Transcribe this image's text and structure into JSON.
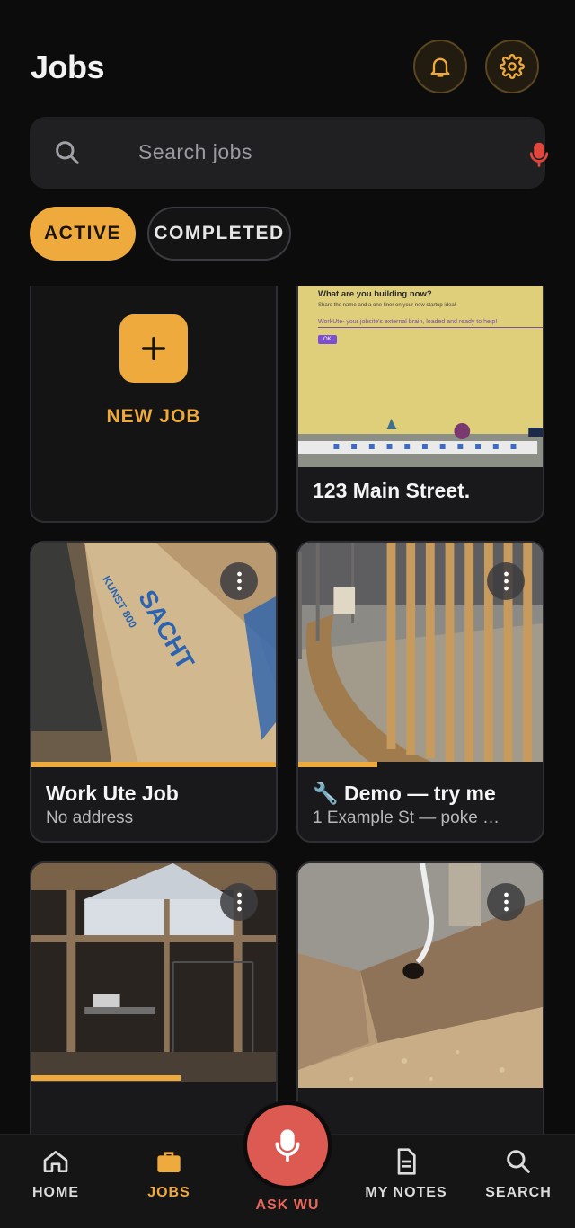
{
  "header": {
    "title": "Jobs",
    "notifications_icon": "bell-icon",
    "settings_icon": "gear-icon",
    "accent_color": "#eeaa3c"
  },
  "search": {
    "placeholder": "Search jobs",
    "search_icon": "search-icon",
    "voice_icon": "mic-icon",
    "mic_color": "#e0463c"
  },
  "filters": {
    "active_label": "ACTIVE",
    "completed_label": "COMPLETED",
    "selected": "ACTIVE"
  },
  "new_job": {
    "label": "NEW JOB",
    "icon": "plus-icon"
  },
  "screen_photo": {
    "question": "What are you building now?",
    "hint": "Share the name and a one-liner on your new startup idea!",
    "answer": "WorkUte- your jobsite's external brain, loaded and ready to help!",
    "ok": "OK"
  },
  "jobs": [
    {
      "title": "123 Main Street.",
      "subtitle": "",
      "progress": 0,
      "menu": false
    },
    {
      "title": "Work Ute Job",
      "subtitle": "No address",
      "progress": 1.0,
      "menu": true
    },
    {
      "title": "🔧 Demo — try me",
      "subtitle": "1 Example St — poke …",
      "progress": 0.32,
      "menu": true
    },
    {
      "title": "",
      "subtitle": "",
      "progress": 0.6,
      "menu": true
    },
    {
      "title": "",
      "subtitle": "",
      "progress": 0,
      "menu": true
    }
  ],
  "bottom_nav": {
    "items": [
      {
        "label": "HOME",
        "icon": "home-icon"
      },
      {
        "label": "JOBS",
        "icon": "briefcase-icon",
        "selected": true
      },
      {
        "label": "MY NOTES",
        "icon": "document-icon"
      },
      {
        "label": "SEARCH",
        "icon": "search-icon"
      }
    ],
    "center": {
      "label": "ASK WU",
      "icon": "mic-icon",
      "color": "#dd5a52"
    }
  }
}
